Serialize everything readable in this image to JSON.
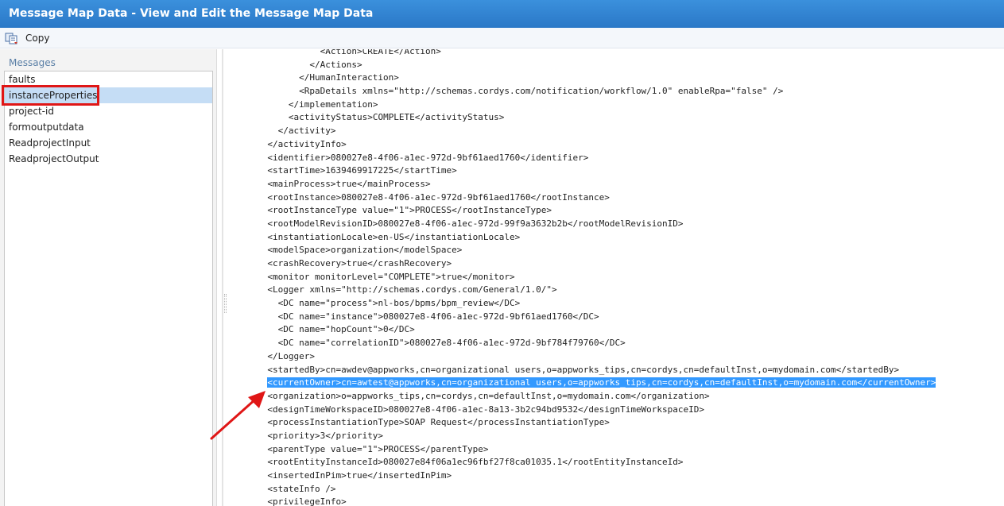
{
  "window": {
    "title": "Message Map Data - View and Edit the Message Map Data"
  },
  "toolbar": {
    "copy_label": "Copy"
  },
  "messages": {
    "heading": "Messages",
    "items": [
      "faults",
      "instanceProperties",
      "project-id",
      "formoutputdata",
      "ReadprojectInput",
      "ReadprojectOutput"
    ],
    "selected": "instanceProperties"
  },
  "xml": {
    "selected_line": 25,
    "lines": [
      "          <Action>CREATE</Action>",
      "        </Actions>",
      "      </HumanInteraction>",
      "      <RpaDetails xmlns=\"http://schemas.cordys.com/notification/workflow/1.0\" enableRpa=\"false\" />",
      "    </implementation>",
      "    <activityStatus>COMPLETE</activityStatus>",
      "  </activity>",
      "</activityInfo>",
      "<identifier>080027e8-4f06-a1ec-972d-9bf61aed1760</identifier>",
      "<startTime>1639469917225</startTime>",
      "<mainProcess>true</mainProcess>",
      "<rootInstance>080027e8-4f06-a1ec-972d-9bf61aed1760</rootInstance>",
      "<rootInstanceType value=\"1\">PROCESS</rootInstanceType>",
      "<rootModelRevisionID>080027e8-4f06-a1ec-972d-99f9a3632b2b</rootModelRevisionID>",
      "<instantiationLocale>en-US</instantiationLocale>",
      "<modelSpace>organization</modelSpace>",
      "<crashRecovery>true</crashRecovery>",
      "<monitor monitorLevel=\"COMPLETE\">true</monitor>",
      "<Logger xmlns=\"http://schemas.cordys.com/General/1.0/\">",
      "  <DC name=\"process\">nl-bos/bpms/bpm_review</DC>",
      "  <DC name=\"instance\">080027e8-4f06-a1ec-972d-9bf61aed1760</DC>",
      "  <DC name=\"hopCount\">0</DC>",
      "  <DC name=\"correlationID\">080027e8-4f06-a1ec-972d-9bf784f79760</DC>",
      "</Logger>",
      "<startedBy>cn=awdev@appworks,cn=organizational users,o=appworks_tips,cn=cordys,cn=defaultInst,o=mydomain.com</startedBy>",
      "<currentOwner>cn=awtest@appworks,cn=organizational users,o=appworks_tips,cn=cordys,cn=defaultInst,o=mydomain.com</currentOwner>",
      "<organization>o=appworks_tips,cn=cordys,cn=defaultInst,o=mydomain.com</organization>",
      "<designTimeWorkspaceID>080027e8-4f06-a1ec-8a13-3b2c94bd9532</designTimeWorkspaceID>",
      "<processInstantiationType>SOAP Request</processInstantiationType>",
      "<priority>3</priority>",
      "<parentType value=\"1\">PROCESS</parentType>",
      "<rootEntityInstanceId>080027e84f06a1ec96fbf27f8ca01035.1</rootEntityInstanceId>",
      "<insertedInPim>true</insertedInPim>",
      "<stateInfo />",
      "<privilegeInfo>"
    ]
  },
  "colors": {
    "title_bar": "#2f80d0",
    "selection": "#3399ff",
    "annotation": "#e01616"
  },
  "icons": {
    "copy": "copy-icon",
    "annotation_arrow": "arrow-icon"
  }
}
